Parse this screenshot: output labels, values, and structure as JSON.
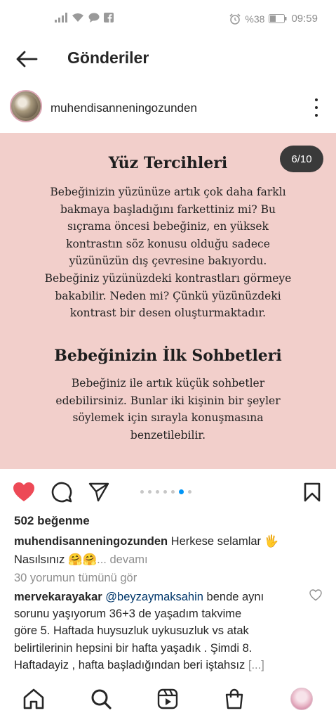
{
  "status_bar": {
    "battery_percent": "%38",
    "time": "09:59"
  },
  "header": {
    "title": "Gönderiler"
  },
  "post": {
    "username": "muhendisanneningozunden",
    "page_indicator": "6/10",
    "slide": {
      "heading1": "Yüz Tercihleri",
      "paragraph1_lines": [
        "Bebeğinizin yüzünüze artık çok daha farklı",
        "bakmaya başladığını farkettiniz mi? Bu",
        "sıçrama öncesi bebeğiniz, en yüksek",
        "kontrastın söz konusu olduğu sadece",
        "yüzünüzün dış çevresine bakıyordu.",
        "Bebeğiniz yüzünüzdeki kontrastları görmeye",
        "bakabilir. Neden mi? Çünkü yüzünüzdeki",
        "kontrast bir desen oluşturmaktadır."
      ],
      "heading2": "Bebeğinizin İlk Sohbetleri",
      "paragraph2_lines": [
        "Bebeğiniz ile artık küçük sohbetler",
        "edebilirsiniz. Bunlar iki kişinin bir şeyler",
        "söylemek için sırayla konuşmasına",
        "benzetilebilir."
      ]
    },
    "carousel": {
      "total_dots": 7,
      "active_index": 5
    },
    "likes": "502 beğenme",
    "caption": {
      "username": "muhendisanneningozunden",
      "text_line1": "Herkese selamlar 🖐",
      "text_line2": "Nasılsınız 🤗🤗",
      "more": "... devamı"
    },
    "view_comments": "30 yorumun tümünü gör",
    "comment": {
      "username": "mervekarayakar",
      "mention": "@beyzaymaksahin",
      "text_first": " bende aynı",
      "lines": [
        "sorunu yaşıyorum 36+3 de yaşadım takvime",
        "göre 5. Haftada huysuzluk uykusuzluk vs atak",
        "belirtilerinin hepsini bir hafta yaşadık . Şimdi 8.",
        "Haftadayiz , hafta başladığından beri iştahsız"
      ],
      "more": "[...]"
    }
  },
  "colors": {
    "slide_background": "#f2cfcb",
    "like_red": "#ed4956",
    "carousel_active": "#0095f6"
  },
  "icons": {
    "back": "back-arrow-icon",
    "like": "heart-filled-icon",
    "comment": "comment-bubble-icon",
    "share": "paper-plane-icon",
    "save": "bookmark-icon",
    "home": "home-icon",
    "search": "search-icon",
    "reels": "reels-icon",
    "shop": "shopping-bag-icon"
  }
}
